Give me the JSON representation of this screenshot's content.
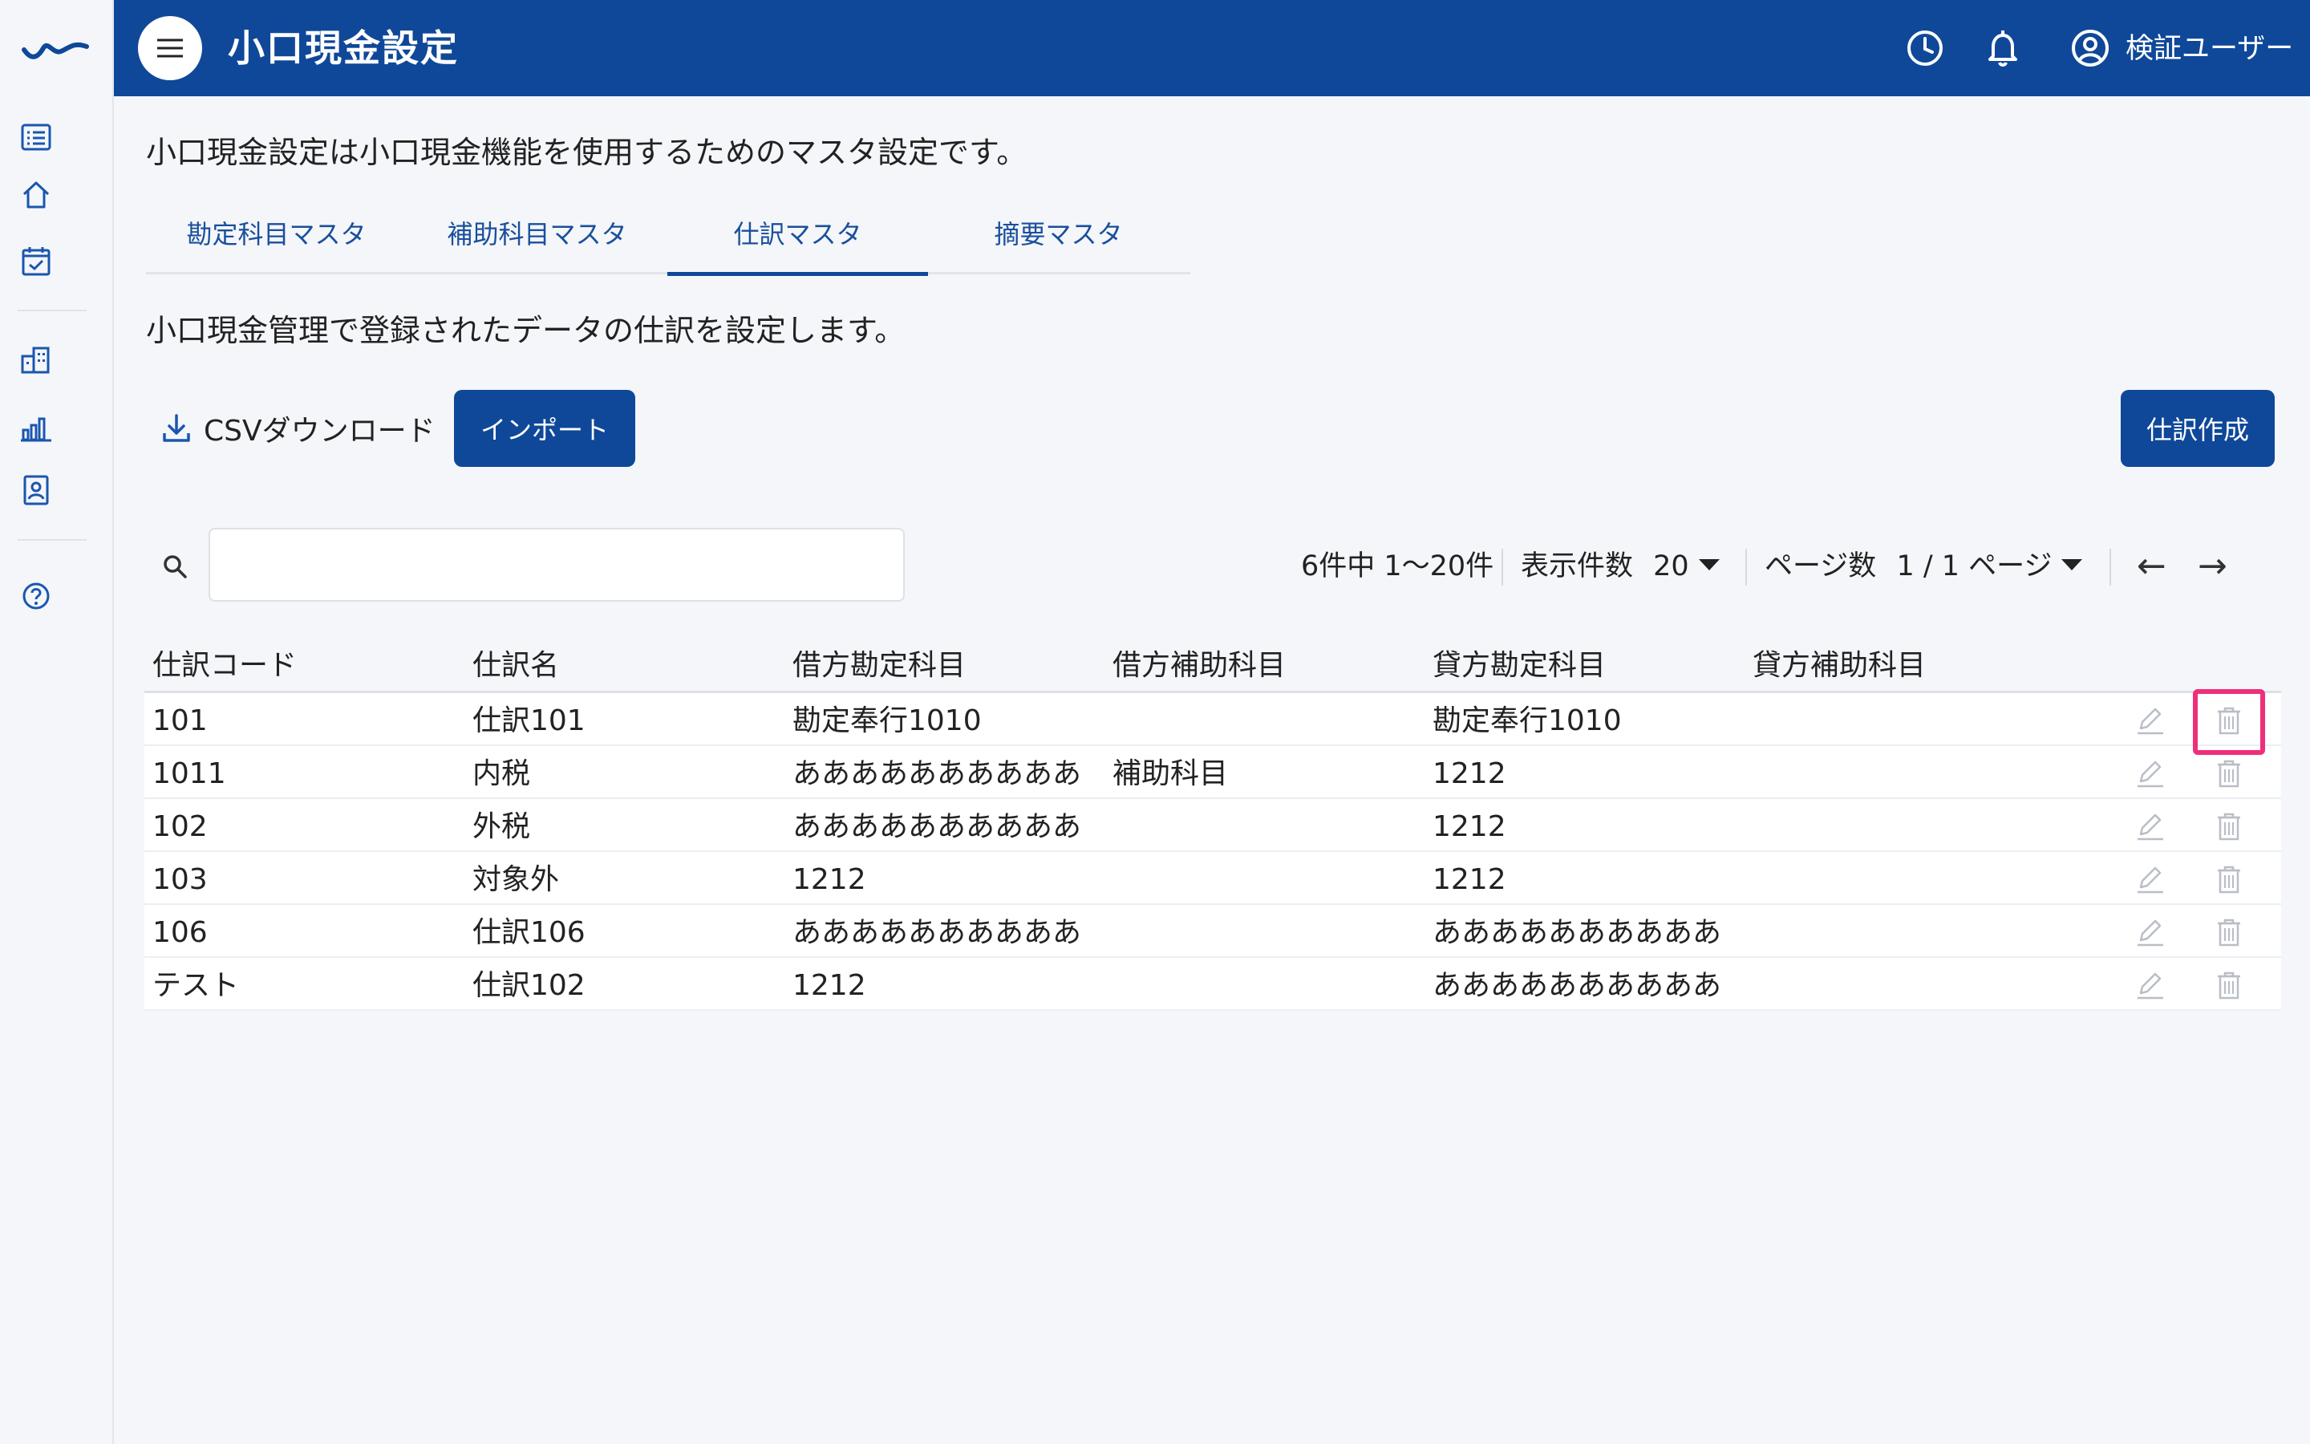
{
  "header": {
    "title": "小口現金設定",
    "user_name": "検証ユーザー"
  },
  "description": "小口現金設定は小口現金機能を使用するためのマスタ設定です。",
  "tabs": [
    {
      "label": "勘定科目マスタ",
      "active": false
    },
    {
      "label": "補助科目マスタ",
      "active": false
    },
    {
      "label": "仕訳マスタ",
      "active": true
    },
    {
      "label": "摘要マスタ",
      "active": false
    }
  ],
  "sub_description": "小口現金管理で登録されたデータの仕訳を設定します。",
  "toolbar": {
    "csv_download_label": "CSVダウンロード",
    "import_label": "インポート",
    "create_label": "仕訳作成"
  },
  "search": {
    "value": "",
    "placeholder": ""
  },
  "pagination": {
    "summary": "6件中 1〜20件",
    "per_page_label": "表示件数",
    "per_page_value": "20",
    "page_label": "ページ数",
    "page_value": "1 / 1 ページ",
    "prev": "←",
    "next": "→"
  },
  "table": {
    "columns": [
      "仕訳コード",
      "仕訳名",
      "借方勘定科目",
      "借方補助科目",
      "貸方勘定科目",
      "貸方補助科目"
    ],
    "rows": [
      [
        "101",
        "仕訳101",
        "勘定奉行1010",
        "",
        "勘定奉行1010",
        ""
      ],
      [
        "1011",
        "内税",
        "ああああああああああ",
        "補助科目",
        "1212",
        ""
      ],
      [
        "102",
        "外税",
        "ああああああああああ",
        "",
        "1212",
        ""
      ],
      [
        "103",
        "対象外",
        "1212",
        "",
        "1212",
        ""
      ],
      [
        "106",
        "仕訳106",
        "ああああああああああ",
        "",
        "ああああああああああ",
        ""
      ],
      [
        "テスト",
        "仕訳102",
        "1212",
        "",
        "ああああああああああ",
        ""
      ]
    ],
    "highlighted_action": "delete-row-1"
  },
  "colors": {
    "primary": "#0f4899",
    "highlight": "#ef2f7a",
    "background": "#f4f6f9"
  },
  "icons": {
    "rail": [
      "brand-logo",
      "list-icon",
      "home-icon",
      "calendar-check-icon",
      "building-icon",
      "bar-chart-icon",
      "id-card-icon",
      "help-icon"
    ],
    "header": [
      "history-icon",
      "bell-icon",
      "user-circle-icon"
    ],
    "row_actions": [
      "edit-icon",
      "trash-icon"
    ]
  }
}
